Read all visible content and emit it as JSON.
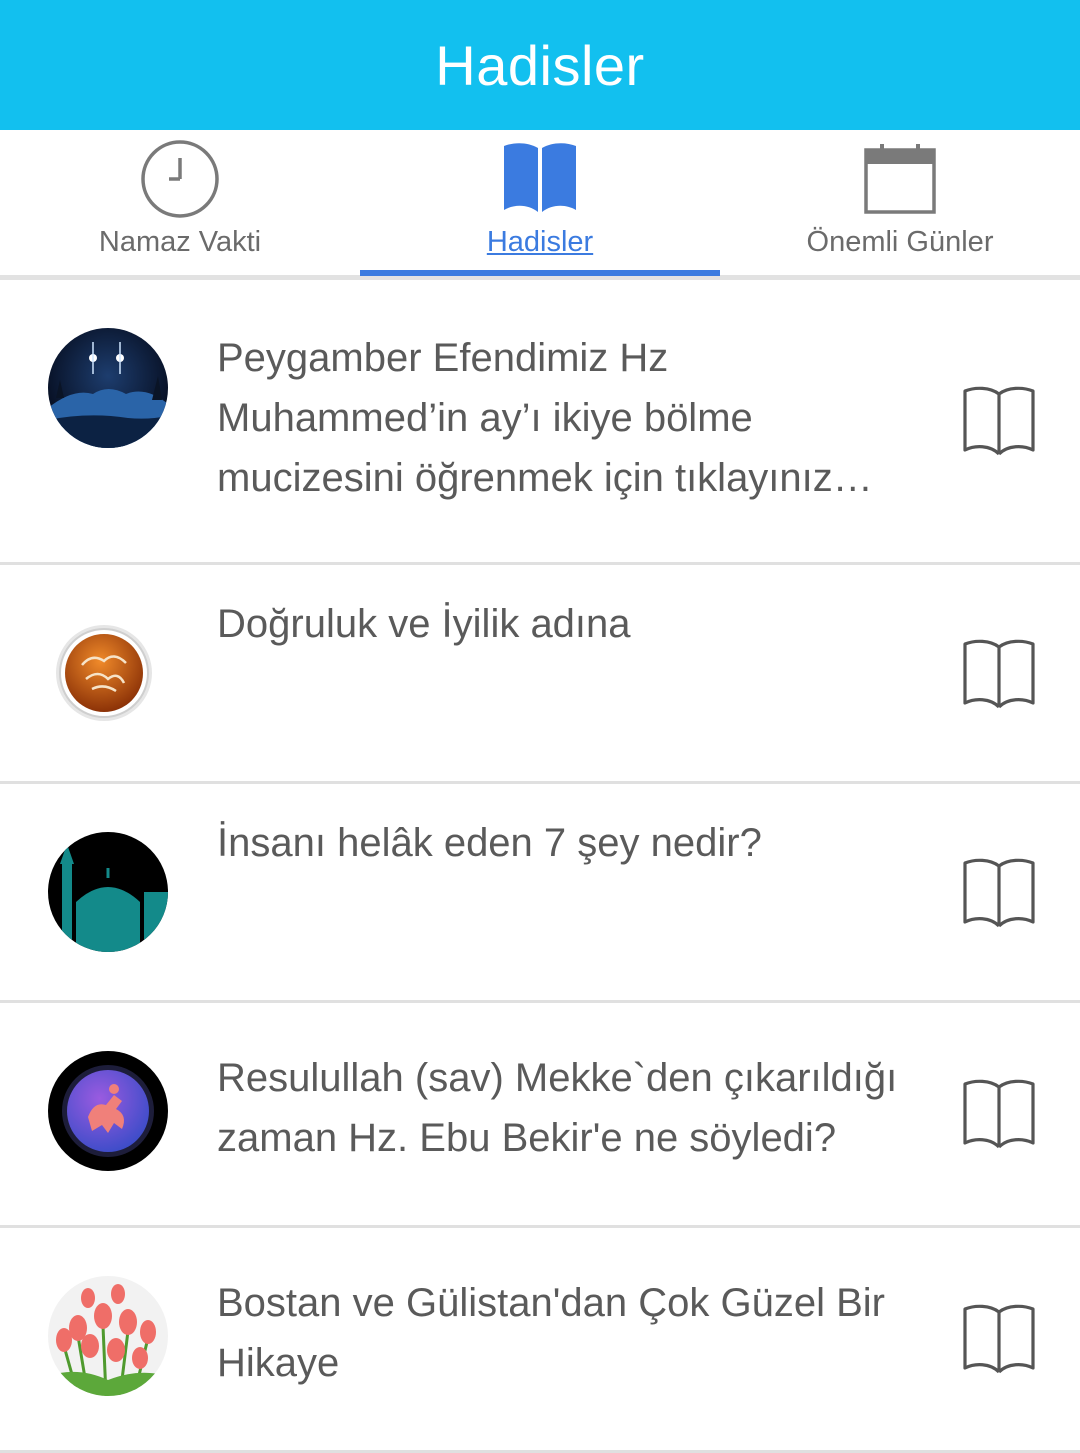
{
  "header": {
    "title": "Hadisler"
  },
  "tabs": [
    {
      "label": "Namaz Vakti",
      "icon": "clock-icon",
      "active": false
    },
    {
      "label": "Hadisler",
      "icon": "book-icon",
      "active": true
    },
    {
      "label": "Önemli Günler",
      "icon": "calendar-icon",
      "active": false
    }
  ],
  "colors": {
    "header_bg": "#12c0ef",
    "accent": "#3b7be0",
    "text": "#5a5a5a",
    "divider": "#e0e0e0"
  },
  "items": [
    {
      "text": "Peygamber Efendimiz Hz Muhammed’in ay’ı ikiye bölme mucizesini öğrenmek için tıklayınız…",
      "image": "night-mountain-moon"
    },
    {
      "text": "Doğruluk ve İyilik adına",
      "image": "calligraphy-medallion"
    },
    {
      "text": "İnsanı helâk eden 7 şey nedir?",
      "image": "mosque-silhouette"
    },
    {
      "text": "Resulullah (sav) Mekke`den çıkarıldığı zaman Hz. Ebu Bekir'e ne söyledi?",
      "image": "horseman-emblem"
    },
    {
      "text": "Bostan ve Gülistan'dan Çok Güzel Bir Hikaye",
      "image": "tulips"
    }
  ]
}
